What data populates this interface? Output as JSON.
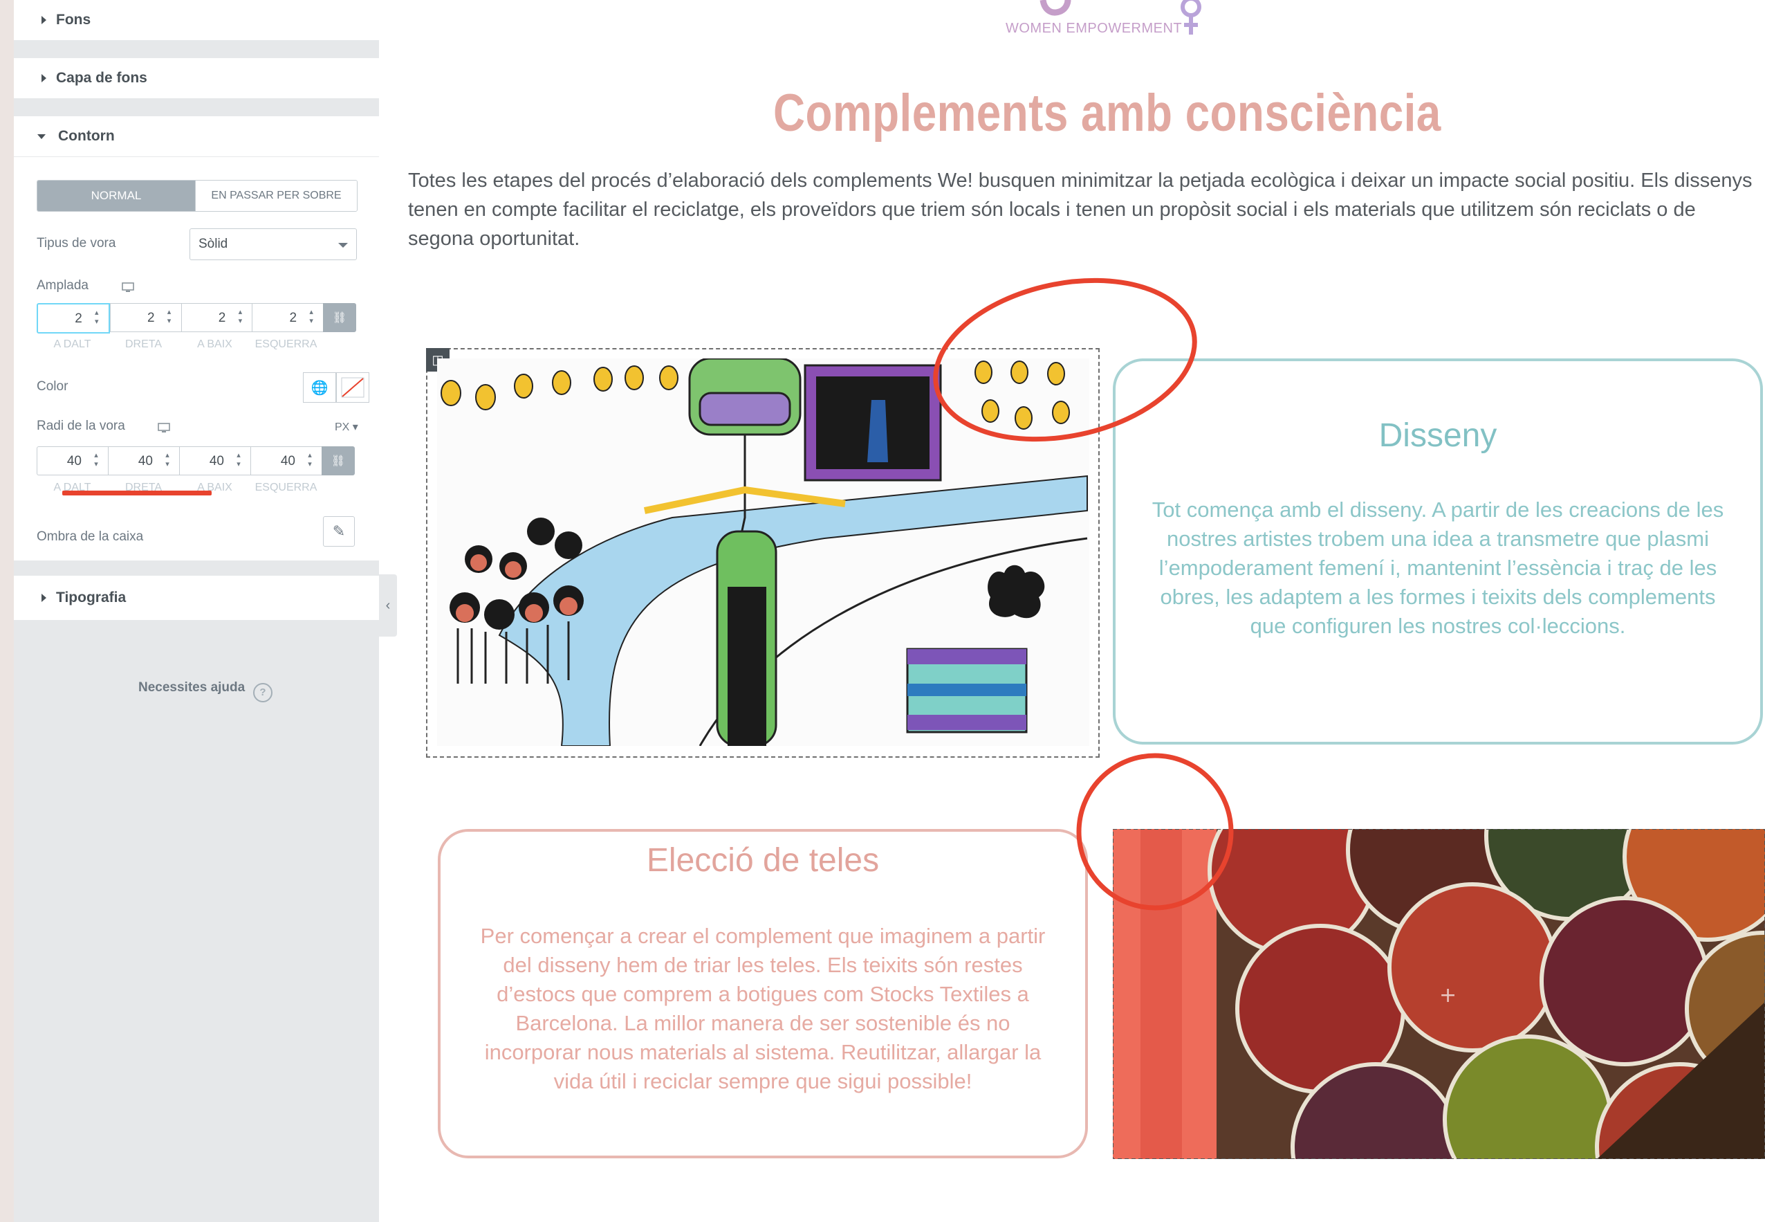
{
  "sidebar": {
    "sections": {
      "fons": "Fons",
      "capa_de_fons": "Capa de fons",
      "contorn": "Contorn",
      "tipografia": "Tipografia"
    },
    "tabs": {
      "normal": "NORMAL",
      "hover": "EN PASSAR PER SOBRE"
    },
    "border_type": {
      "label": "Tipus de vora",
      "value": "Sòlid"
    },
    "width": {
      "label": "Amplada",
      "values": [
        "2",
        "2",
        "2",
        "2"
      ],
      "sides": [
        "A DALT",
        "DRETA",
        "A BAIX",
        "ESQUERRA"
      ]
    },
    "color": {
      "label": "Color"
    },
    "radius": {
      "label": "Radi de la vora",
      "unit": "PX",
      "values": [
        "40",
        "40",
        "40",
        "40"
      ],
      "sides": [
        "A DALT",
        "DRETA",
        "A BAIX",
        "ESQUERRA"
      ]
    },
    "box_shadow": {
      "label": "Ombra de la caixa"
    },
    "help": "Necessites ajuda"
  },
  "preview": {
    "logo_text": "WOMEN EMPOWERMENT",
    "title": "Complements amb consciència",
    "intro": "Totes les etapes del procés d’elaboració dels complements We! busquen minimitzar la petjada ecològica i deixar un impacte social positiu. Els dissenys tenen en compte facilitar el reciclatge, els proveïdors que triem són locals i tenen un propòsit social i els materials que utilitzem són reciclats o de segona oportunitat.",
    "disseny": {
      "title": "Disseny",
      "text": "Tot comença amb el disseny. A partir de les creacions de les nostres artistes trobem una idea a transmetre que plasmi l’empoderament femení i, mantenint l’essència i traç de les obres, les adaptem a les formes i teixits dels complements que configuren les nostres col·leccions."
    },
    "teles": {
      "title": "Elecció de teles",
      "text": "Per començar a crear el complement que imaginem a partir del disseny hem de triar les teles. Els teixits són restes d’estocs que comprem a botigues com Stocks Textiles a Barcelona. La millor manera de ser sostenible és no incorporar nous materials al sistema. Reutilitzar, allargar la vida útil i reciclar sempre que sigui possible!"
    }
  },
  "colors": {
    "accent_pink": "#e2a9a1",
    "accent_teal": "#82c1c4",
    "annotation_red": "#e8432e",
    "logo_purple": "#c59ec9"
  }
}
